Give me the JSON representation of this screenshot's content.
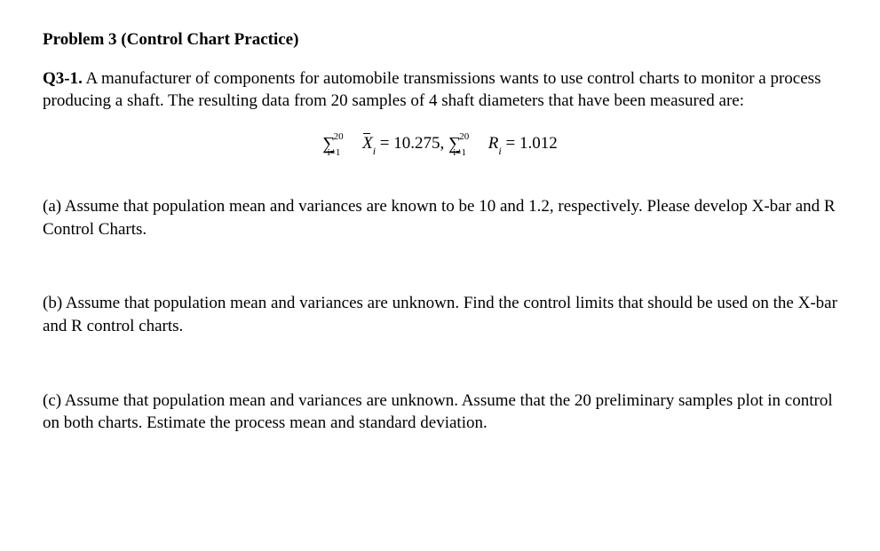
{
  "title": "Problem 3 (Control Chart Practice)",
  "intro": {
    "label": "Q3-1.",
    "text": " A manufacturer of components for automobile transmissions wants to use control charts to monitor a process producing a shaft. The resulting data from 20 samples of 4 shaft diameters that have been measured are:"
  },
  "equation": {
    "sum_upper": "20",
    "sum_lower": "i=1",
    "xbar_symbol": "X",
    "xbar_sub": "i",
    "eq1_value": " = 10.275,  ",
    "r_symbol": "R",
    "r_sub": "i",
    "eq2_value": " = 1.012"
  },
  "parts": {
    "a": "(a) Assume that population mean and variances are known to be 10 and 1.2, respectively. Please develop X-bar and R Control Charts.",
    "b": "(b) Assume that population mean and variances are unknown. Find the control limits that should be used on the X-bar and R control charts.",
    "c": "(c) Assume that population mean and variances are unknown. Assume that the 20 preliminary samples plot in control on both charts. Estimate the process mean and standard deviation."
  }
}
